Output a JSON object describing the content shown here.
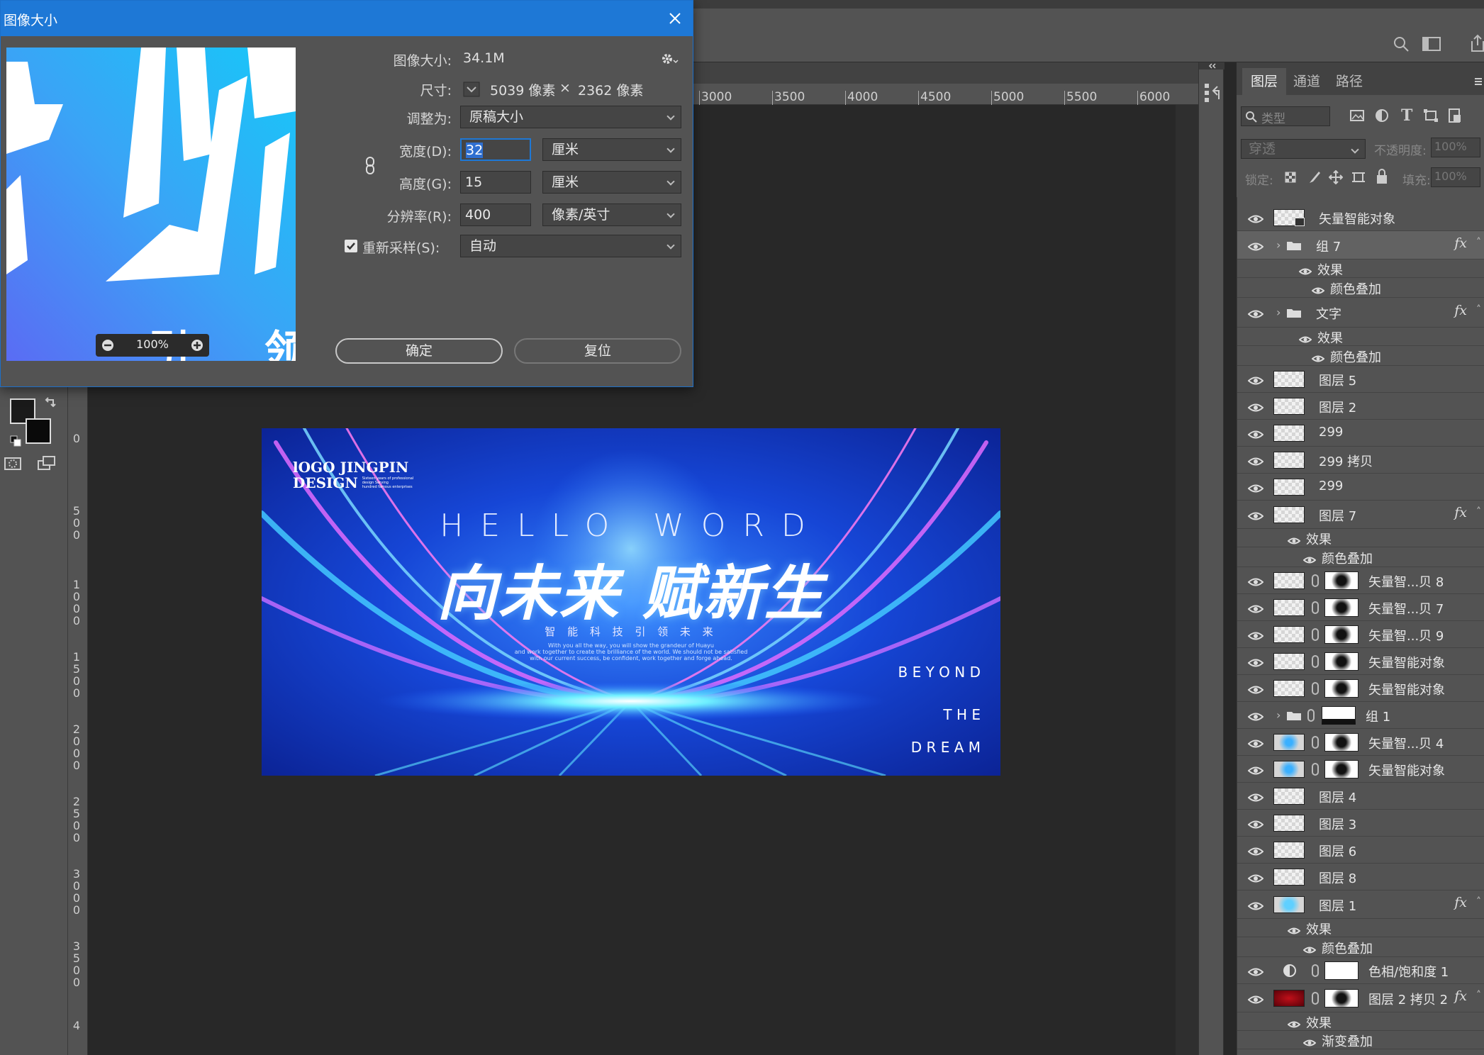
{
  "dialog": {
    "title": "图像大小",
    "image_size_label": "图像大小:",
    "image_size_value": "34.1M",
    "dimensions_label": "尺寸:",
    "dimensions_width": "5039 像素",
    "dimensions_times": "×",
    "dimensions_height": "2362 像素",
    "fit_label": "调整为:",
    "fit_value": "原稿大小",
    "width_label": "宽度(D):",
    "width_value": "32",
    "width_unit": "厘米",
    "height_label": "高度(G):",
    "height_value": "15",
    "height_unit": "厘米",
    "resolution_label": "分辨率(R):",
    "resolution_value": "400",
    "resolution_unit": "像素/英寸",
    "resample_label": "重新采样(S):",
    "resample_value": "自动",
    "resample_checked": true,
    "ok_label": "确定",
    "reset_label": "复位",
    "preview_zoom": "100%",
    "preview_chars": [
      "引",
      "领"
    ]
  },
  "ruler": {
    "horizontal": [
      "3000",
      "3500",
      "4000",
      "4500",
      "5000",
      "5500",
      "6000"
    ],
    "vertical": [
      "0",
      "500",
      "1000",
      "1500",
      "2000",
      "2500",
      "3000",
      "3500",
      "4"
    ]
  },
  "canvas": {
    "logo_line1": "lOGO JINGPIN",
    "logo_line2": "DESIGN",
    "logo_tagline1": "Sixteen years of professional",
    "logo_tagline2": "design Serving",
    "logo_tagline3": "hundred famous enterprises",
    "hello": "HELLO WORD",
    "headline": "向未来 赋新生",
    "subline": "智 能 科 技   引 领 未 来",
    "body1": "With you all the way, you will show the grandeur of Huayu",
    "body2": "and work together to create the brilliance of the world. We should not be satisfied",
    "body3": "with our current success, be confident, work together and forge ahead.",
    "beyond": "B E Y O N D",
    "the": "T H E",
    "dream": "D R E A M"
  },
  "layers_panel": {
    "tabs": [
      "图层",
      "通道",
      "路径"
    ],
    "search_placeholder": "类型",
    "blend_mode": "穿透",
    "opacity_label": "不透明度:",
    "opacity_value": "100%",
    "lock_label": "锁定:",
    "fill_label": "填充:",
    "fill_value": "100%",
    "layers": [
      {
        "name": "矢量智能对象"
      },
      {
        "name": "组 7",
        "fx": "fx"
      },
      {
        "name": "效果"
      },
      {
        "name": "颜色叠加"
      },
      {
        "name": "文字",
        "fx": "fx"
      },
      {
        "name": "效果"
      },
      {
        "name": "颜色叠加"
      },
      {
        "name": "图层 5"
      },
      {
        "name": "图层 2"
      },
      {
        "name": "299"
      },
      {
        "name": "299 拷贝"
      },
      {
        "name": "299"
      },
      {
        "name": "图层 7",
        "fx": "fx"
      },
      {
        "name": "效果"
      },
      {
        "name": "颜色叠加"
      },
      {
        "name": "矢量智...贝 8"
      },
      {
        "name": "矢量智...贝 7"
      },
      {
        "name": "矢量智...贝 9"
      },
      {
        "name": "矢量智能对象"
      },
      {
        "name": "矢量智能对象"
      },
      {
        "name": "组 1"
      },
      {
        "name": "矢量智...贝 4"
      },
      {
        "name": "矢量智能对象"
      },
      {
        "name": "图层 4"
      },
      {
        "name": "图层 3"
      },
      {
        "name": "图层 6"
      },
      {
        "name": "图层 8"
      },
      {
        "name": "图层 1",
        "fx": "fx"
      },
      {
        "name": "效果"
      },
      {
        "name": "颜色叠加"
      },
      {
        "name": "色相/饱和度 1"
      },
      {
        "name": "图层 2 拷贝 2",
        "fx": "fx"
      },
      {
        "name": "效果"
      },
      {
        "name": "渐变叠加"
      }
    ]
  },
  "colors": {
    "dialog_title_bg": "#1e78d6",
    "panel_bg": "#535353",
    "workspace_bg": "#282828"
  }
}
